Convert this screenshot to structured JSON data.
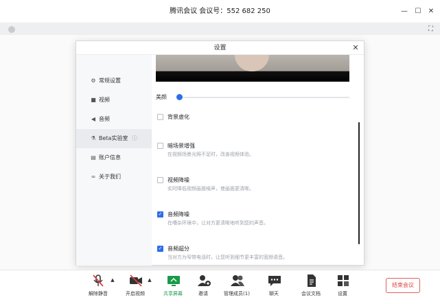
{
  "window": {
    "title": "腾讯会议 会议号：552 682 250",
    "min_glyph": "—",
    "max_glyph": "☐",
    "close_glyph": "✕",
    "fullscreen_glyph": "⛶"
  },
  "dialog": {
    "title": "设置",
    "close_glyph": "✕",
    "sidebar": [
      {
        "label": "常规设置",
        "icon": "gear-icon",
        "glyph": "⚙"
      },
      {
        "label": "视频",
        "icon": "video-icon",
        "glyph": "■"
      },
      {
        "label": "音频",
        "icon": "speaker-icon",
        "glyph": "◀"
      },
      {
        "label": "Beta实验室",
        "icon": "beaker-icon",
        "glyph": "⚗",
        "help_glyph": "ⓘ"
      },
      {
        "label": "账户信息",
        "icon": "id-card-icon",
        "glyph": "▤"
      },
      {
        "label": "关于我们",
        "icon": "logo-icon",
        "glyph": "∞"
      }
    ],
    "active_sidebar_index": 3,
    "beauty_label": "美颜",
    "beauty_level": 0,
    "options": [
      {
        "label": "背景虚化",
        "desc": "",
        "checked": false
      },
      {
        "label": "暗场景增强",
        "desc": "在视频场景光照不足时，改善视频体验。",
        "checked": false
      },
      {
        "label": "视频降噪",
        "desc": "实时降低视频画面噪声，使画面更清晰。",
        "checked": false
      },
      {
        "label": "音频降噪",
        "desc": "在嘈杂环境中，让对方更清晰地听到您的声音。",
        "checked": true
      },
      {
        "label": "音频超分",
        "desc": "当对方为窄带电话时，让您听到细节更丰富的宽频语音。",
        "checked": true
      }
    ],
    "check_glyph": "✓"
  },
  "toolbar": {
    "buttons": [
      {
        "label": "解除静音",
        "icon": "mic-muted-icon"
      },
      {
        "label": "开启视频",
        "icon": "camera-off-icon"
      },
      {
        "label": "共享屏幕",
        "icon": "screen-share-icon"
      },
      {
        "label": "邀请",
        "icon": "add-user-icon"
      },
      {
        "label": "管理成员(1)",
        "icon": "members-icon"
      },
      {
        "label": "聊天",
        "icon": "chat-icon"
      },
      {
        "label": "会议文档",
        "icon": "document-icon"
      },
      {
        "label": "设置",
        "icon": "grid-settings-icon"
      }
    ],
    "caret_glyph": "▲",
    "end_label": "结束会议",
    "share_color": "#1a9a4a",
    "end_color": "#e04040"
  },
  "colors": {
    "accent": "#2d6ee9"
  }
}
